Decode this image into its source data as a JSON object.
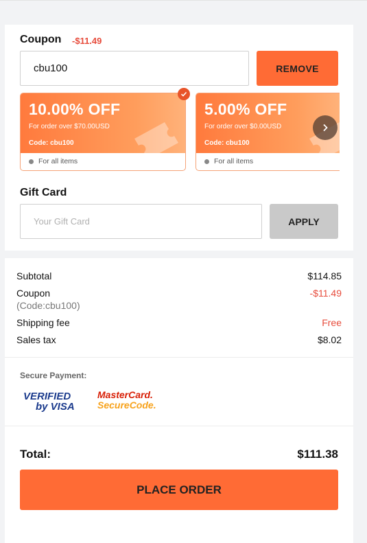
{
  "coupon": {
    "title": "Coupon",
    "discount": "-$11.49",
    "code_value": "cbu100",
    "remove_label": "REMOVE",
    "tickets": [
      {
        "percent": "10.00% OFF",
        "condition": "For order over $70.00USD",
        "code": "Code: cbu100",
        "scope": "For all items",
        "selected": true
      },
      {
        "percent": "5.00% OFF",
        "condition": "For order over $0.00USD",
        "code": "Code: cbu100",
        "scope": "For all items",
        "selected": false
      }
    ]
  },
  "gift_card": {
    "title": "Gift Card",
    "placeholder": "Your Gift Card",
    "apply_label": "APPLY"
  },
  "summary": {
    "subtotal_label": "Subtotal",
    "subtotal_value": "$114.85",
    "coupon_label": "Coupon",
    "coupon_code": "(Code:cbu100)",
    "coupon_value": "-$11.49",
    "shipping_label": "Shipping fee",
    "shipping_value": "Free",
    "tax_label": "Sales tax",
    "tax_value": "$8.02"
  },
  "payment": {
    "secure_label": "Secure Payment:",
    "logos": [
      "Verified by Visa",
      "MasterCard SecureCode"
    ]
  },
  "total": {
    "label": "Total:",
    "value": "$111.38",
    "place_order_label": "PLACE ORDER"
  },
  "colors": {
    "accent": "#ff6b35",
    "discount_red": "#e74c3c",
    "disabled_button": "#c9c9c9"
  },
  "icons": [
    "check-icon",
    "chevron-right-icon",
    "ticket-icon",
    "dot-icon"
  ]
}
